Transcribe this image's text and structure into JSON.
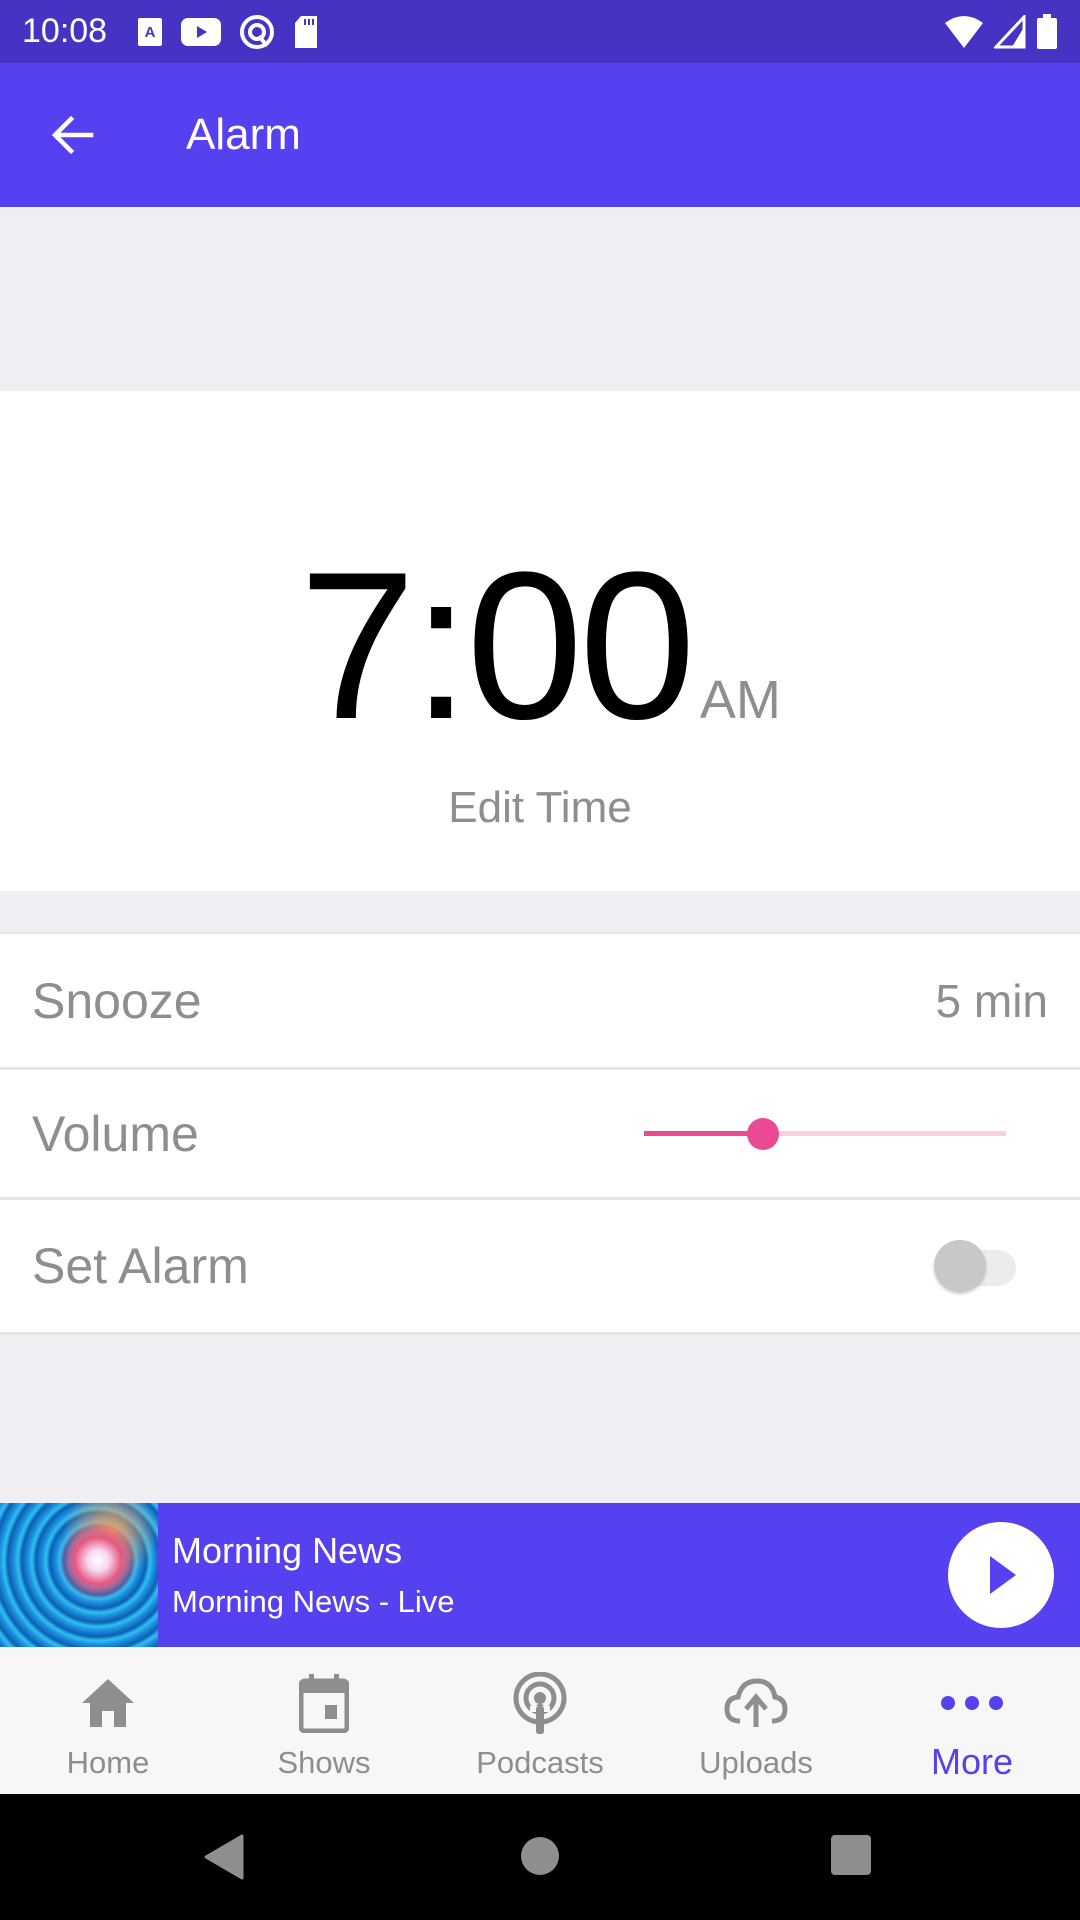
{
  "status_bar": {
    "time": "10:08",
    "left_icons": [
      "font-download-icon",
      "youtube-icon",
      "at-sign-icon",
      "sd-card-icon"
    ],
    "right_icons": [
      "wifi-icon",
      "cell-signal-icon",
      "battery-icon"
    ]
  },
  "app_bar": {
    "back_icon": "arrow-left-icon",
    "title": "Alarm"
  },
  "alarm": {
    "time": "7:00",
    "period": "AM",
    "edit_label": "Edit Time"
  },
  "settings": {
    "snooze": {
      "label": "Snooze",
      "value": "5 min"
    },
    "volume": {
      "label": "Volume",
      "level_fraction": 0.33
    },
    "set_alarm": {
      "label": "Set Alarm",
      "enabled": false
    }
  },
  "mini_player": {
    "title": "Morning News",
    "subtitle": "Morning News - Live",
    "play_icon": "play-icon"
  },
  "bottom_nav": {
    "items": [
      {
        "label": "Home",
        "icon": "home-icon",
        "active": false
      },
      {
        "label": "Shows",
        "icon": "calendar-icon",
        "active": false
      },
      {
        "label": "Podcasts",
        "icon": "podcast-icon",
        "active": false
      },
      {
        "label": "Uploads",
        "icon": "cloud-upload-icon",
        "active": false
      },
      {
        "label": "More",
        "icon": "more-horizontal-icon",
        "active": true
      }
    ]
  },
  "colors": {
    "primary": "#5541ef",
    "status_bar": "#4534c4",
    "accent_pink": "#ea4a93",
    "text_muted": "#8e8e8e"
  }
}
